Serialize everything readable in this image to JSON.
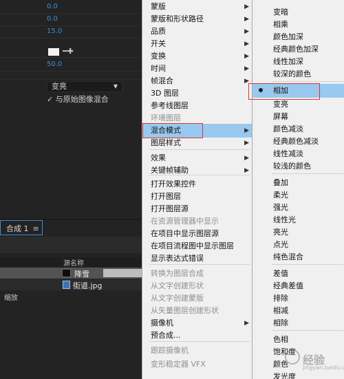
{
  "properties": {
    "values": [
      "0.0",
      "0.0",
      "15.0",
      "50.0"
    ],
    "blend_dropdown": "变亮",
    "blend_original_checkbox": "与原始图像混合",
    "checkbox_mark": "✓"
  },
  "composition": {
    "tab_label": "合成 1",
    "tab_menu_icon": "≡",
    "column_source_name": "源名称",
    "layers": [
      {
        "name": "降雪",
        "icon": "solid-swatch"
      },
      {
        "name": "街道.jpg",
        "icon": "image-file-icon"
      }
    ],
    "scale_label": "缩放"
  },
  "layer_menu": {
    "items": [
      {
        "label": "蒙版",
        "submenu": true,
        "disabled": false
      },
      {
        "label": "蒙版和形状路径",
        "submenu": true,
        "disabled": false
      },
      {
        "label": "品质",
        "submenu": true,
        "disabled": false
      },
      {
        "label": "开关",
        "submenu": true,
        "disabled": false
      },
      {
        "label": "变换",
        "submenu": true,
        "disabled": false
      },
      {
        "label": "时间",
        "submenu": true,
        "disabled": false
      },
      {
        "label": "帧混合",
        "submenu": true,
        "disabled": false
      },
      {
        "label": "3D 图层",
        "submenu": false,
        "disabled": false
      },
      {
        "label": "参考线图层",
        "submenu": false,
        "disabled": false
      },
      {
        "label": "环境图层",
        "submenu": false,
        "disabled": true
      },
      {
        "label": "混合模式",
        "submenu": true,
        "disabled": false,
        "highlighted": true
      },
      {
        "label": "图层样式",
        "submenu": true,
        "disabled": false
      },
      {
        "label": "效果",
        "submenu": true,
        "disabled": false
      },
      {
        "label": "关键帧辅助",
        "submenu": true,
        "disabled": false
      },
      {
        "label": "打开效果控件",
        "submenu": false,
        "disabled": false
      },
      {
        "label": "打开图层",
        "submenu": false,
        "disabled": false
      },
      {
        "label": "打开图层源",
        "submenu": false,
        "disabled": false
      },
      {
        "label": "在资源管理器中显示",
        "submenu": false,
        "disabled": true
      },
      {
        "label": "在项目中显示图层源",
        "submenu": false,
        "disabled": false
      },
      {
        "label": "在项目流程图中显示图层",
        "submenu": false,
        "disabled": false
      },
      {
        "label": "显示表达式错误",
        "submenu": false,
        "disabled": false
      },
      {
        "label": "转换为图层合成",
        "submenu": false,
        "disabled": true
      },
      {
        "label": "从文字创建形状",
        "submenu": false,
        "disabled": true
      },
      {
        "label": "从文字创建蒙版",
        "submenu": false,
        "disabled": true
      },
      {
        "label": "从矢量图层创建形状",
        "submenu": false,
        "disabled": true
      },
      {
        "label": "摄像机",
        "submenu": true,
        "disabled": false
      },
      {
        "label": "预合成...",
        "submenu": false,
        "disabled": false
      },
      {
        "label": "跟踪摄像机",
        "submenu": false,
        "disabled": true
      },
      {
        "label": "变形稳定器 VFX",
        "submenu": false,
        "disabled": true
      }
    ],
    "submenu_arrow": "▶"
  },
  "blend_menu": {
    "items": [
      {
        "label": "变暗"
      },
      {
        "label": "相乘"
      },
      {
        "label": "颜色加深"
      },
      {
        "label": "经典颜色加深"
      },
      {
        "label": "线性加深"
      },
      {
        "label": "较深的颜色"
      },
      {
        "label": "相加",
        "selected": true,
        "highlighted": true
      },
      {
        "label": "变亮"
      },
      {
        "label": "屏幕"
      },
      {
        "label": "颜色减淡"
      },
      {
        "label": "经典颜色减淡"
      },
      {
        "label": "线性减淡"
      },
      {
        "label": "较浅的颜色"
      },
      {
        "label": "叠加"
      },
      {
        "label": "柔光"
      },
      {
        "label": "强光"
      },
      {
        "label": "线性光"
      },
      {
        "label": "亮光"
      },
      {
        "label": "点光"
      },
      {
        "label": "纯色混合"
      },
      {
        "label": "差值"
      },
      {
        "label": "经典差值"
      },
      {
        "label": "排除"
      },
      {
        "label": "相减"
      },
      {
        "label": "相除"
      },
      {
        "label": "色相"
      },
      {
        "label": "饱和度"
      },
      {
        "label": "颜色"
      },
      {
        "label": "发光度"
      }
    ]
  },
  "watermark": {
    "text": "经验",
    "url": "jingyan.baidu.com"
  },
  "colors": {
    "menu_bg": "#f0f0f0",
    "highlight": "#99c9ef",
    "panel_bg": "#232323",
    "accent_value": "#3a8fd9",
    "annotation_red": "#d9362f"
  }
}
